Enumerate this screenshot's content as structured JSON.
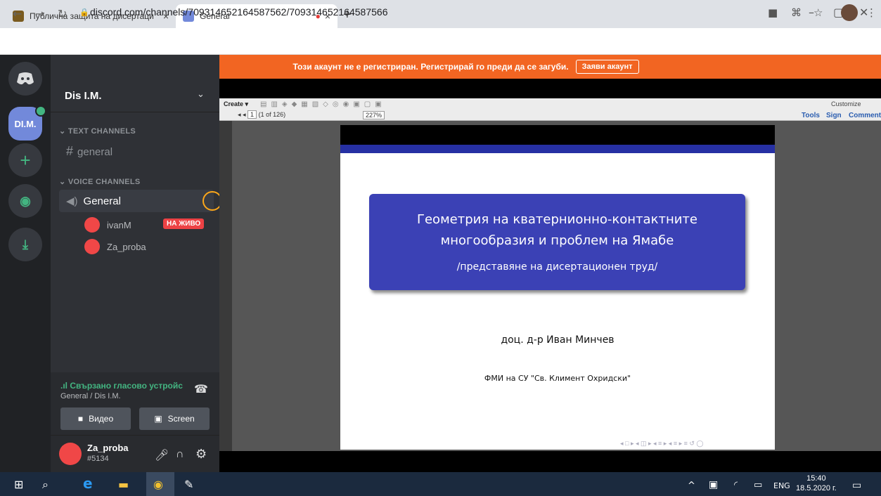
{
  "browser": {
    "tabs": [
      {
        "title": "Публична защита на дисертаци",
        "close": "×"
      },
      {
        "title": "General",
        "close": "×"
      }
    ],
    "new_tab": "+",
    "url": "discord.com/channels/709314652164587562/709314652164587566",
    "window_controls": [
      "–",
      "▢",
      "✕"
    ]
  },
  "discord": {
    "banner_text": "Този акаунт не е регистриран. Регистрирай го преди да се загуби.",
    "banner_button": "Заяви акаунт",
    "guild_label": "DI.M.",
    "server_name": "Dis I.M.",
    "text_category": "TEXT CHANNELS",
    "text_channel": "general",
    "voice_category": "VOICE CHANNELS",
    "voice_channel": "General",
    "voice_users": [
      "ivanM",
      "Za_proba"
    ],
    "live_badge": "НА ЖИВО",
    "voice_status": "Свързано гласово устройс",
    "voice_location": "General / Dis I.M.",
    "video_button": "Видео",
    "screen_button": "Screen",
    "username": "Za_proba",
    "discriminator": "#5134"
  },
  "pdf": {
    "create_label": "Create",
    "page_input": "1",
    "page_count": "(1 of 126)",
    "zoom": "227%",
    "customize": "Customize",
    "tools": "Tools",
    "sign": "Sign",
    "comment": "Comment",
    "title_line1": "Геометрия на кватернионно-контактните",
    "title_line2": "многообразия и проблем на Ямабе",
    "subtitle": "/представяне на дисертационен труд/",
    "author": "доц. д-р Иван Минчев",
    "institution": "ФМИ на СУ \"Св. Климент Охридски\""
  },
  "taskbar": {
    "lang": "ENG",
    "time": "15:40",
    "date": "18.5.2020 г."
  },
  "colors": {
    "discord_orange": "#f26522",
    "blurple": "#7289da",
    "slide_blue": "#3b41b5"
  }
}
